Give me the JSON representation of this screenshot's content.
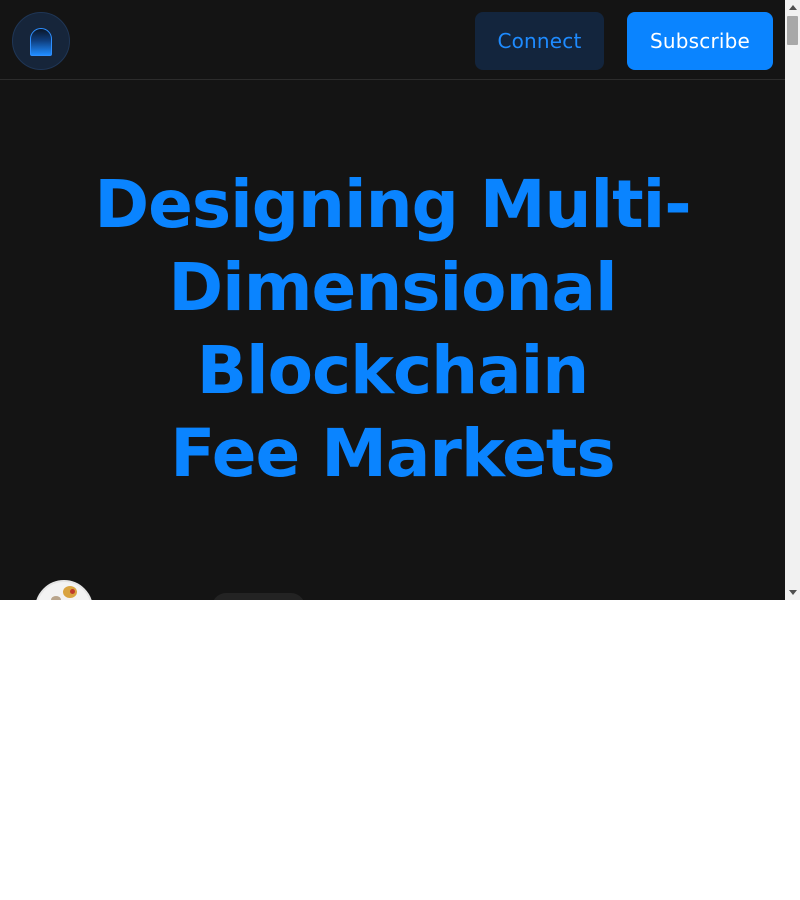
{
  "header": {
    "logo_icon": "arch-logo-icon",
    "connect_label": "Connect",
    "subscribe_label": "Subscribe"
  },
  "article": {
    "title_lines": [
      "Designing Multi-",
      "Dimensional",
      "Blockchain",
      "Fee Markets"
    ]
  },
  "author": {
    "avatar_icon": "author-avatar"
  },
  "colors": {
    "background": "#141414",
    "accent": "#0a84ff",
    "connect_bg": "#13253d",
    "subscribe_bg": "#0a84ff"
  },
  "scrollbar": {
    "up_icon": "scroll-up-arrow-icon",
    "down_icon": "scroll-down-arrow-icon"
  }
}
